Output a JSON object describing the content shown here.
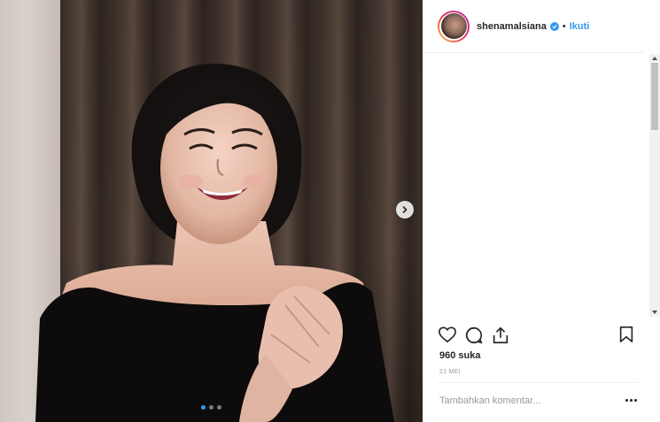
{
  "post": {
    "author": {
      "username": "shenamalsiana",
      "verified": true,
      "separator": "•",
      "follow_label": "Ikuti"
    },
    "media": {
      "description_icon": "photo",
      "carousel": {
        "count": 3,
        "active_index": 0
      },
      "next_icon": "chevron-right-icon"
    },
    "actions": {
      "like_icon": "heart-icon",
      "comment_icon": "speech-bubble-icon",
      "share_icon": "share-icon",
      "save_icon": "bookmark-icon"
    },
    "likes_text": "960 suka",
    "date_text": "21 MEI",
    "comment_box": {
      "placeholder": "Tambahkan komentar...",
      "more_icon": "more-options-icon"
    }
  },
  "colors": {
    "accent": "#3897f0",
    "text": "#262626",
    "muted": "#999999",
    "divider": "#efefef"
  }
}
